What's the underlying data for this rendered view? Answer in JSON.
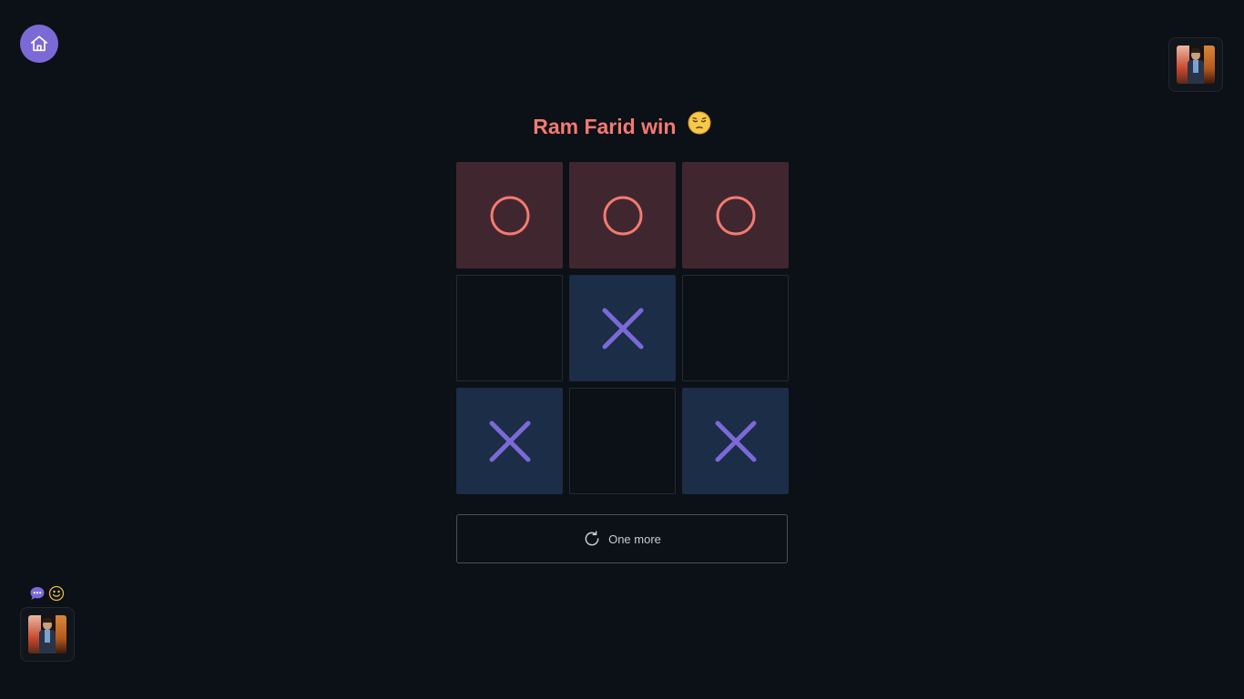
{
  "header": {
    "home_icon": "home-icon"
  },
  "status": {
    "text": "Ram Farid win",
    "emoji_icon": "pensive-face-icon",
    "color": "#f47a72"
  },
  "board": {
    "cells": [
      {
        "mark": "O"
      },
      {
        "mark": "O"
      },
      {
        "mark": "O"
      },
      {
        "mark": ""
      },
      {
        "mark": "X"
      },
      {
        "mark": ""
      },
      {
        "mark": "X"
      },
      {
        "mark": ""
      },
      {
        "mark": "X"
      }
    ],
    "colors": {
      "o_mark": "#f47a72",
      "o_cell": "#40272f",
      "x_mark": "#7b6ad6",
      "x_cell": "#1b2d47"
    }
  },
  "actions": {
    "play_again_label": "One more",
    "play_again_icon": "refresh-icon"
  },
  "players": {
    "opponent_avatar": "player-photo",
    "self_avatar": "player-photo",
    "chat_icon": "chat-bubble-icon",
    "emoji_icon": "smiley-icon"
  },
  "theme": {
    "background": "#0c1017",
    "accent": "#7b6ad6"
  }
}
